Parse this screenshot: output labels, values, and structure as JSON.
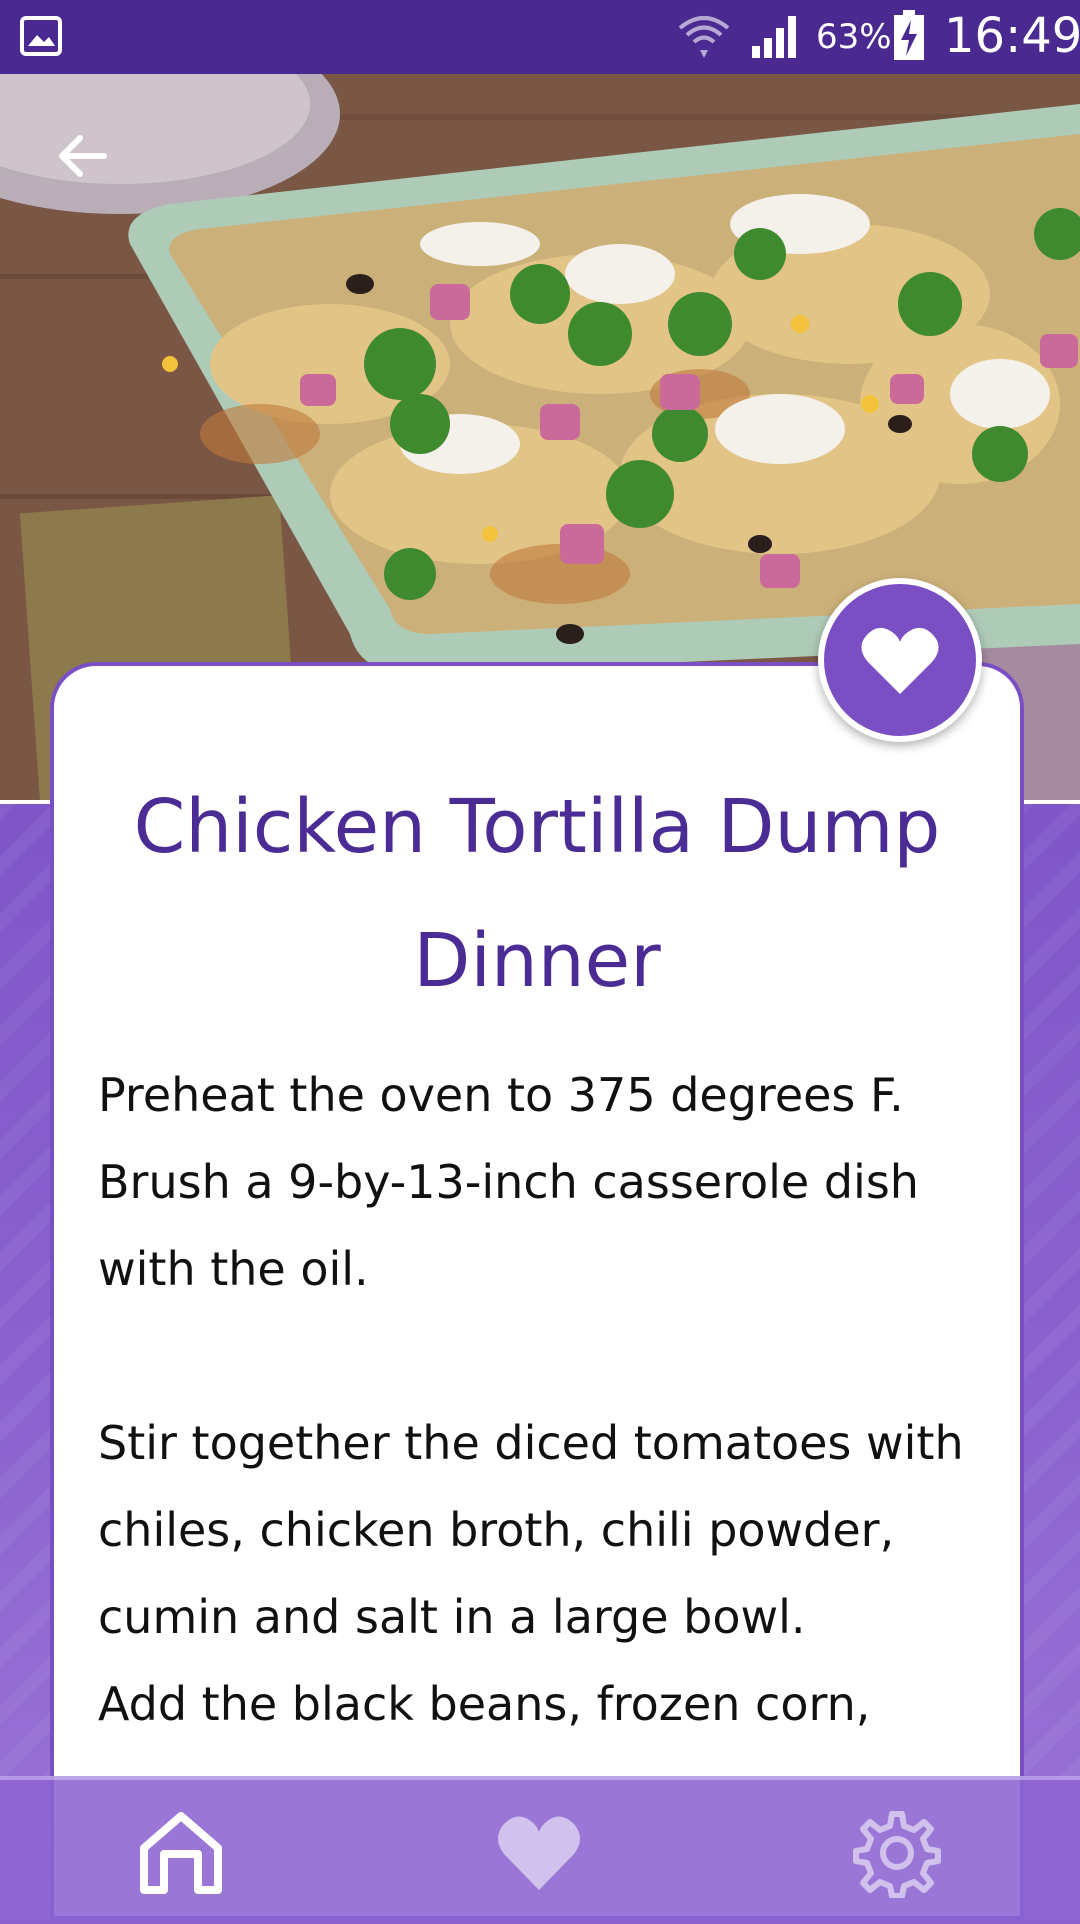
{
  "status_bar": {
    "battery_percent": "63%",
    "time": "16:49",
    "icons": [
      "gallery-icon",
      "wifi-icon",
      "signal-icon",
      "battery-charging-icon"
    ]
  },
  "header": {
    "back_icon": "arrow-left-icon"
  },
  "recipe": {
    "title": "Chicken Tortilla Dump Dinner",
    "paragraphs": [
      "Preheat the oven to 375 degrees F. Brush a 9-by-13-inch casserole dish with the oil.",
      "Stir together the diced tomatoes with chiles, chicken broth, chili powder, cumin and salt in a large bowl.",
      "Add the black beans, frozen corn,"
    ],
    "favorite_icon": "heart-icon"
  },
  "bottom_nav": {
    "items": [
      "home-icon",
      "heart-icon",
      "gear-icon"
    ]
  },
  "colors": {
    "primary": "#4b2c95",
    "accent": "#7b4fc4",
    "status_bar": "#4a2a91"
  }
}
